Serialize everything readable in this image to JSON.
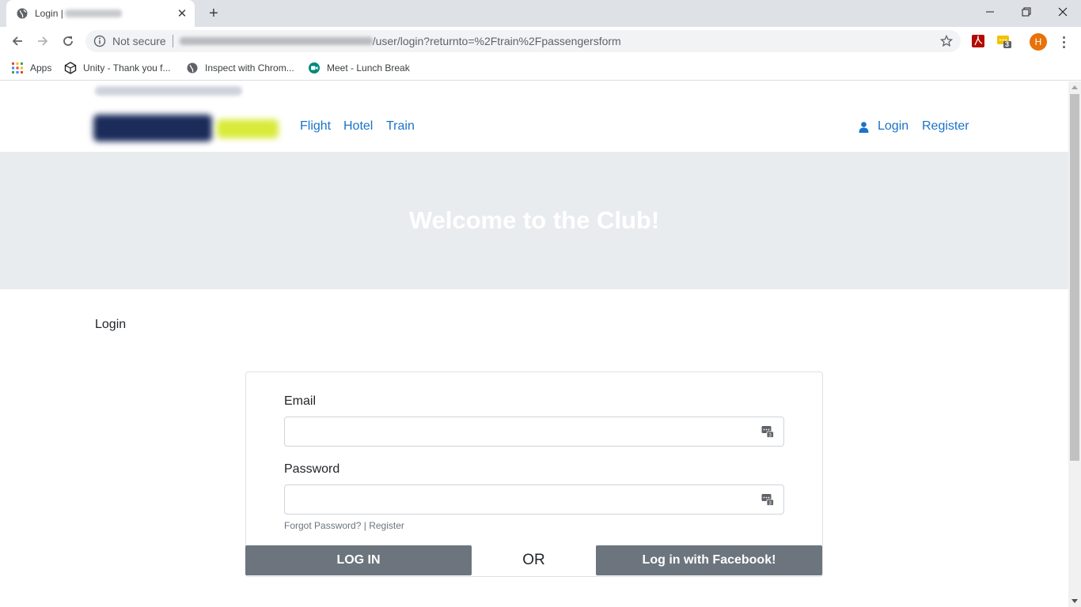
{
  "browser": {
    "tab": {
      "title": "Login |"
    },
    "address": {
      "security_label": "Not secure",
      "url_path": "/user/login?returnto=%2Ftrain%2Fpassengersform"
    },
    "profile_initial": "H",
    "extension_badge": "3",
    "bookmarks": [
      {
        "label": "Apps",
        "icon": "apps-grid-icon"
      },
      {
        "label": "Unity - Thank you f...",
        "icon": "unity-icon"
      },
      {
        "label": "Inspect with Chrom...",
        "icon": "globe-icon"
      },
      {
        "label": "Meet - Lunch Break",
        "icon": "meet-icon"
      }
    ]
  },
  "site": {
    "nav": {
      "flight": "Flight",
      "hotel": "Hotel",
      "train": "Train",
      "login": "Login",
      "register": "Register"
    },
    "hero_title": "Welcome to the Club!",
    "page_label": "Login",
    "form": {
      "email_label": "Email",
      "email_value": "",
      "password_label": "Password",
      "password_value": "",
      "forgot_password": "Forgot Password?",
      "link_separator": "|",
      "register_link": "Register",
      "login_button": "LOG IN",
      "or_text": "OR",
      "facebook_button": "Log in with Facebook!"
    }
  },
  "colors": {
    "link": "#1a73c9",
    "hero_bg": "#e9ecef",
    "button_bg": "#6c757d"
  }
}
